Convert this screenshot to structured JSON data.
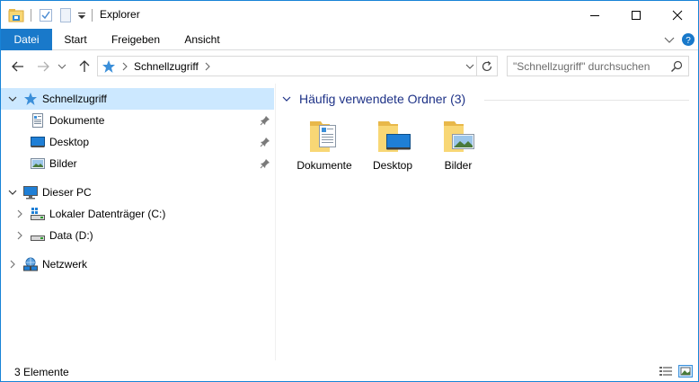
{
  "window": {
    "title": "Explorer"
  },
  "ribbon": {
    "tabs": [
      {
        "label": "Datei"
      },
      {
        "label": "Start"
      },
      {
        "label": "Freigeben"
      },
      {
        "label": "Ansicht"
      }
    ]
  },
  "address": {
    "path": [
      {
        "label": "Schnellzugriff"
      }
    ]
  },
  "search": {
    "placeholder": "\"Schnellzugriff\" durchsuchen"
  },
  "nav": {
    "quick_access": {
      "label": "Schnellzugriff",
      "items": [
        {
          "label": "Dokumente",
          "icon": "documents-icon"
        },
        {
          "label": "Desktop",
          "icon": "desktop-icon"
        },
        {
          "label": "Bilder",
          "icon": "pictures-icon"
        }
      ]
    },
    "this_pc": {
      "label": "Dieser PC",
      "items": [
        {
          "label": "Lokaler Datenträger (C:)",
          "icon": "drive-c-icon"
        },
        {
          "label": "Data (D:)",
          "icon": "drive-icon"
        }
      ]
    },
    "network": {
      "label": "Netzwerk"
    }
  },
  "main": {
    "group_title": "Häufig verwendete Ordner (3)",
    "folders": [
      {
        "label": "Dokumente",
        "icon": "documents-folder-icon"
      },
      {
        "label": "Desktop",
        "icon": "desktop-folder-icon"
      },
      {
        "label": "Bilder",
        "icon": "pictures-folder-icon"
      }
    ]
  },
  "status": {
    "item_count": "3 Elemente"
  },
  "colors": {
    "accent": "#1979ca",
    "selection": "#cce8ff",
    "group_title": "#1e3287",
    "folder": "#f8d775"
  }
}
